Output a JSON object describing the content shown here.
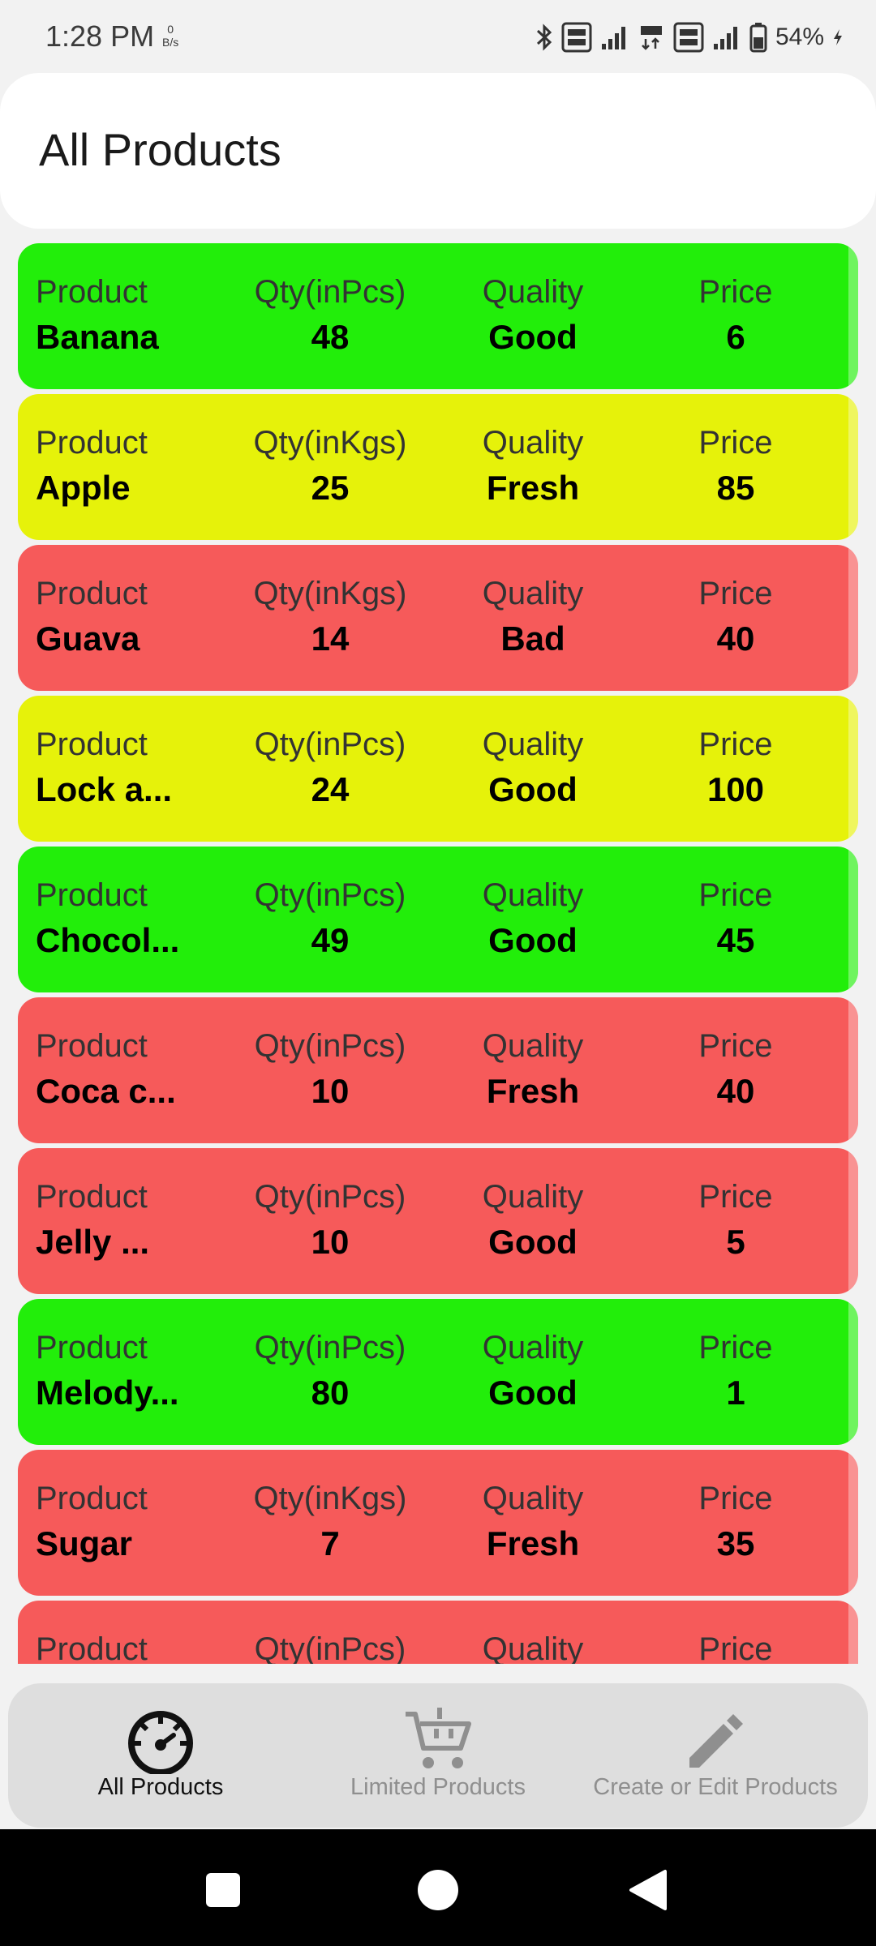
{
  "status_bar": {
    "time": "1:28 PM",
    "speed_value": "0",
    "speed_unit": "B/s",
    "battery": "54%"
  },
  "header": {
    "title": "All Products"
  },
  "products": [
    {
      "product_label": "Product",
      "name": "Banana",
      "qty_label": "Qty(inPcs)",
      "qty": "48",
      "quality_label": "Quality",
      "quality": "Good",
      "price_label": "Price",
      "price": "6",
      "color": "#22ee0a"
    },
    {
      "product_label": "Product",
      "name": "Apple",
      "qty_label": "Qty(inKgs)",
      "qty": "25",
      "quality_label": "Quality",
      "quality": "Fresh",
      "price_label": "Price",
      "price": "85",
      "color": "#e6f20a"
    },
    {
      "product_label": "Product",
      "name": "Guava",
      "qty_label": "Qty(inKgs)",
      "qty": "14",
      "quality_label": "Quality",
      "quality": "Bad",
      "price_label": "Price",
      "price": "40",
      "color": "#f65a5a"
    },
    {
      "product_label": "Product",
      "name": "Lock a...",
      "qty_label": "Qty(inPcs)",
      "qty": "24",
      "quality_label": "Quality",
      "quality": "Good",
      "price_label": "Price",
      "price": "100",
      "color": "#e6f20a"
    },
    {
      "product_label": "Product",
      "name": "Chocol...",
      "qty_label": "Qty(inPcs)",
      "qty": "49",
      "quality_label": "Quality",
      "quality": "Good",
      "price_label": "Price",
      "price": "45",
      "color": "#22ee0a"
    },
    {
      "product_label": "Product",
      "name": "Coca c...",
      "qty_label": "Qty(inPcs)",
      "qty": "10",
      "quality_label": "Quality",
      "quality": "Fresh",
      "price_label": "Price",
      "price": "40",
      "color": "#f65a5a"
    },
    {
      "product_label": "Product",
      "name": "Jelly ...",
      "qty_label": "Qty(inPcs)",
      "qty": "10",
      "quality_label": "Quality",
      "quality": "Good",
      "price_label": "Price",
      "price": "5",
      "color": "#f65a5a"
    },
    {
      "product_label": "Product",
      "name": "Melody...",
      "qty_label": "Qty(inPcs)",
      "qty": "80",
      "quality_label": "Quality",
      "quality": "Good",
      "price_label": "Price",
      "price": "1",
      "color": "#22ee0a"
    },
    {
      "product_label": "Product",
      "name": "Sugar",
      "qty_label": "Qty(inKgs)",
      "qty": "7",
      "quality_label": "Quality",
      "quality": "Fresh",
      "price_label": "Price",
      "price": "35",
      "color": "#f65a5a"
    },
    {
      "product_label": "Product",
      "name": "",
      "qty_label": "Qty(inPcs)",
      "qty": "",
      "quality_label": "Quality",
      "quality": "",
      "price_label": "Price",
      "price": "",
      "color": "#f65a5a"
    }
  ],
  "bottom_nav": {
    "items": [
      {
        "label": "All Products",
        "icon": "speedometer-icon",
        "active": true
      },
      {
        "label": "Limited Products",
        "icon": "cart-icon",
        "active": false
      },
      {
        "label": "Create or Edit Products",
        "icon": "pencil-icon",
        "active": false
      }
    ]
  },
  "system_nav": {
    "buttons": [
      "recents-button",
      "home-button",
      "back-button"
    ]
  },
  "colors": {
    "good": "#22ee0a",
    "warn": "#e6f20a",
    "bad": "#f65a5a"
  }
}
